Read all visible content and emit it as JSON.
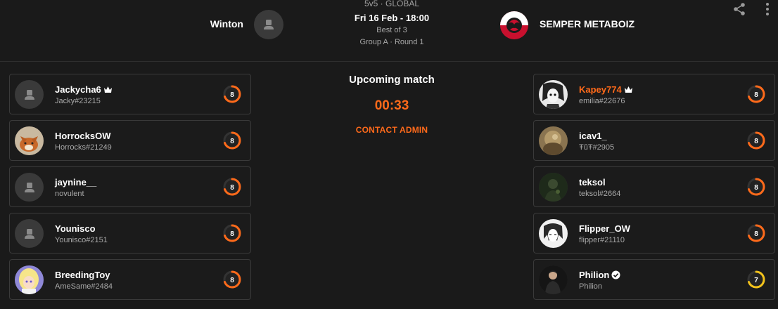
{
  "header": {
    "mode": "5v5 · GLOBAL",
    "date": "Fri 16 Feb - 18:00",
    "format": "Best of 3",
    "group": "Group A · Round 1",
    "team_left": "Winton",
    "team_right": "SEMPER METABOIZ"
  },
  "center": {
    "status": "Upcoming match",
    "timer": "00:33",
    "contact_label": "CONTACT ADMIN"
  },
  "left_players": [
    {
      "name": "Jackycha6",
      "tag": "Jacky#23215",
      "rating": "8",
      "captain": true,
      "avatar": "default"
    },
    {
      "name": "HorrocksOW",
      "tag": "Horrocks#21249",
      "rating": "8",
      "captain": false,
      "avatar": "fox"
    },
    {
      "name": "jaynine__",
      "tag": "novulent",
      "rating": "8",
      "captain": false,
      "avatar": "default"
    },
    {
      "name": "Younisco",
      "tag": "Younisco#2151",
      "rating": "8",
      "captain": false,
      "avatar": "default"
    },
    {
      "name": "BreedingToy",
      "tag": "AmeSame#2484",
      "rating": "8",
      "captain": false,
      "avatar": "anime"
    }
  ],
  "right_players": [
    {
      "name": "Kapey774",
      "tag": "emilia#22676",
      "rating": "8",
      "captain": true,
      "avatar": "manga"
    },
    {
      "name": "icav1_",
      "tag": "ŦŭŦ#2905",
      "rating": "8",
      "captain": false,
      "avatar": "photo-tan"
    },
    {
      "name": "teksol",
      "tag": "teksol#2664",
      "rating": "8",
      "captain": false,
      "avatar": "photo-green"
    },
    {
      "name": "Flipper_OW",
      "tag": "flipper#21110",
      "rating": "8",
      "captain": false,
      "avatar": "sketch"
    },
    {
      "name": "Philion",
      "tag": "Philion",
      "rating": "7",
      "captain": false,
      "verified": true,
      "avatar": "photo-dark"
    }
  ],
  "colors": {
    "accent": "#ff6a1a",
    "rating_orange": "#ff6a1a",
    "rating_yellow": "#f2c21b",
    "background": "#1a1a1a",
    "border": "#3a3a3a"
  }
}
